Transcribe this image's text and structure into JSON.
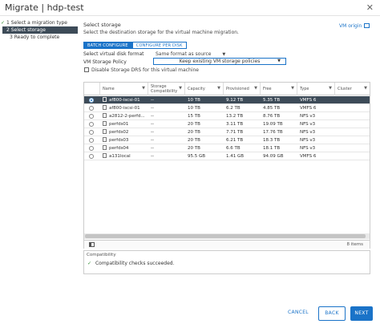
{
  "window": {
    "title": "Migrate | hdp-test",
    "close_glyph": "✕"
  },
  "steps": [
    {
      "label": "1 Select a migration type",
      "state": "done"
    },
    {
      "label": "2 Select storage",
      "state": "active"
    },
    {
      "label": "3 Ready to complete",
      "state": "pending"
    }
  ],
  "section": {
    "title": "Select storage",
    "description": "Select the destination storage for the virtual machine migration.",
    "vm_origin_link": "VM origin"
  },
  "tabs": [
    {
      "label": "BATCH CONFIGURE",
      "selected": true
    },
    {
      "label": "CONFIGURE PER DISK",
      "selected": false
    }
  ],
  "disk_format": {
    "label": "Select virtual disk format",
    "value": "Same format as source"
  },
  "storage_policy": {
    "label": "VM Storage Policy",
    "value": "Keep existing VM storage policies"
  },
  "drs": {
    "label": "Disable Storage DRS for this virtual machine",
    "checked": false
  },
  "grid": {
    "columns": [
      "Name",
      "Storage Compatibility",
      "Capacity",
      "Provisioned",
      "Free",
      "Type",
      "Cluster"
    ],
    "rows": [
      {
        "name": "af800-iscsi-01",
        "compat": "--",
        "capacity": "10 TB",
        "provisioned": "9.12 TB",
        "free": "5.35 TB",
        "type": "VMFS 6",
        "cluster": "",
        "selected": true
      },
      {
        "name": "af800-iscsi-01",
        "compat": "--",
        "capacity": "10 TB",
        "provisioned": "6.2 TB",
        "free": "4.85 TB",
        "type": "VMFS 6",
        "cluster": "",
        "selected": false
      },
      {
        "name": "a2812-2-perfd...",
        "compat": "--",
        "capacity": "15 TB",
        "provisioned": "13.2 TB",
        "free": "8.76 TB",
        "type": "NFS v3",
        "cluster": "",
        "selected": false
      },
      {
        "name": "perfds01",
        "compat": "--",
        "capacity": "20 TB",
        "provisioned": "3.11 TB",
        "free": "19.09 TB",
        "type": "NFS v3",
        "cluster": "",
        "selected": false
      },
      {
        "name": "perfds02",
        "compat": "--",
        "capacity": "20 TB",
        "provisioned": "7.71 TB",
        "free": "17.76 TB",
        "type": "NFS v3",
        "cluster": "",
        "selected": false
      },
      {
        "name": "perfds03",
        "compat": "--",
        "capacity": "20 TB",
        "provisioned": "6.21 TB",
        "free": "18.3 TB",
        "type": "NFS v3",
        "cluster": "",
        "selected": false
      },
      {
        "name": "perfds04",
        "compat": "--",
        "capacity": "20 TB",
        "provisioned": "6.6 TB",
        "free": "18.1 TB",
        "type": "NFS v3",
        "cluster": "",
        "selected": false
      },
      {
        "name": "a131local",
        "compat": "--",
        "capacity": "95.5 GB",
        "provisioned": "1.41 GB",
        "free": "94.09 GB",
        "type": "VMFS 6",
        "cluster": "",
        "selected": false
      }
    ],
    "footer_count": "8 items"
  },
  "compatibility": {
    "title": "Compatibility",
    "message": "Compatibility checks succeeded."
  },
  "buttons": {
    "cancel": "CANCEL",
    "back": "BACK",
    "next": "NEXT"
  },
  "colors": {
    "accent": "#1a73c8",
    "selected_row": "#3d4b58",
    "success": "#2e8b2e"
  }
}
